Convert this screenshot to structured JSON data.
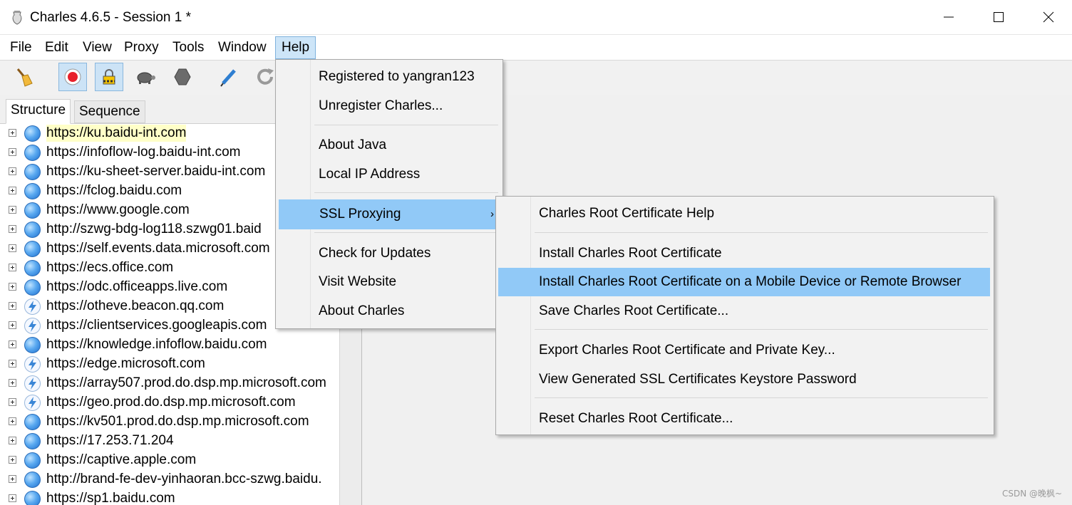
{
  "window": {
    "title": "Charles 4.6.5 - Session 1 *",
    "controls": {
      "minimize": "—",
      "maximize": "☐",
      "close": "✕"
    }
  },
  "menubar": [
    "File",
    "Edit",
    "View",
    "Proxy",
    "Tools",
    "Window",
    "Help"
  ],
  "toolbar": {
    "buttons": [
      "broom-icon",
      "record-icon",
      "ssl-lock-icon",
      "throttle-turtle-icon",
      "breakpoint-hexagon-icon",
      "compose-pen-icon",
      "repeat-icon"
    ]
  },
  "tabs": {
    "structure": "Structure",
    "sequence": "Sequence"
  },
  "hosts": [
    {
      "url": "https://ku.baidu-int.com",
      "icon": "globe",
      "highlight": true
    },
    {
      "url": "https://infoflow-log.baidu-int.com",
      "icon": "globe"
    },
    {
      "url": "https://ku-sheet-server.baidu-int.com",
      "icon": "globe"
    },
    {
      "url": "https://fclog.baidu.com",
      "icon": "globe"
    },
    {
      "url": "https://www.google.com",
      "icon": "globe"
    },
    {
      "url": "http://szwg-bdg-log118.szwg01.baid",
      "icon": "globe"
    },
    {
      "url": "https://self.events.data.microsoft.com",
      "icon": "globe"
    },
    {
      "url": "https://ecs.office.com",
      "icon": "globe"
    },
    {
      "url": "https://odc.officeapps.live.com",
      "icon": "globe"
    },
    {
      "url": "https://otheve.beacon.qq.com",
      "icon": "bolt"
    },
    {
      "url": "https://clientservices.googleapis.com",
      "icon": "bolt"
    },
    {
      "url": "https://knowledge.infoflow.baidu.com",
      "icon": "globe"
    },
    {
      "url": "https://edge.microsoft.com",
      "icon": "bolt"
    },
    {
      "url": "https://array507.prod.do.dsp.mp.microsoft.com",
      "icon": "bolt"
    },
    {
      "url": "https://geo.prod.do.dsp.mp.microsoft.com",
      "icon": "bolt"
    },
    {
      "url": "https://kv501.prod.do.dsp.mp.microsoft.com",
      "icon": "globe"
    },
    {
      "url": "https://17.253.71.204",
      "icon": "globe"
    },
    {
      "url": "https://captive.apple.com",
      "icon": "globe"
    },
    {
      "url": "http://brand-fe-dev-yinhaoran.bcc-szwg.baidu.",
      "icon": "globe"
    },
    {
      "url": "https://sp1.baidu.com",
      "icon": "globe"
    }
  ],
  "help_menu": {
    "items": [
      {
        "label": "Registered to yangran123"
      },
      {
        "label": "Unregister Charles..."
      },
      {
        "label": "About Java"
      },
      {
        "label": "Local IP Address"
      },
      {
        "label": "SSL Proxying",
        "submenu_arrow": "›",
        "selected": true
      },
      {
        "label": "Check for Updates"
      },
      {
        "label": "Visit Website"
      },
      {
        "label": "About Charles"
      }
    ]
  },
  "ssl_menu": {
    "items": [
      {
        "label": "Charles Root Certificate Help"
      },
      {
        "label": "Install Charles Root Certificate"
      },
      {
        "label": "Install Charles Root Certificate on a Mobile Device or Remote Browser",
        "selected": true
      },
      {
        "label": "Save Charles Root Certificate..."
      },
      {
        "label": "Export Charles Root Certificate and Private Key..."
      },
      {
        "label": "View Generated SSL Certificates Keystore Password"
      },
      {
        "label": "Reset Charles Root Certificate..."
      }
    ]
  },
  "watermark": "CSDN @晚枫~",
  "colors": {
    "menu_selection": "#91c9f7",
    "host_highlight": "#ffffc8",
    "open_menu": "#cde5f8"
  }
}
